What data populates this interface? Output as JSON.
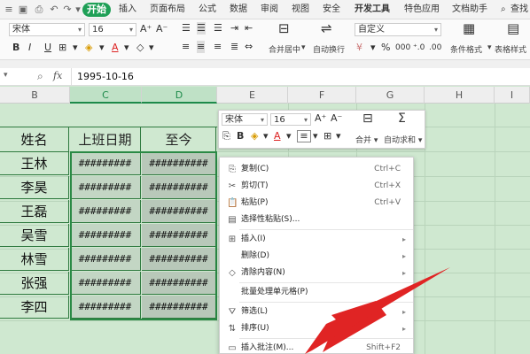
{
  "menubar": {
    "tabs": [
      "开始",
      "插入",
      "页面布局",
      "公式",
      "数据",
      "审阅",
      "视图",
      "安全",
      "开发工具",
      "特色应用",
      "文档助手"
    ],
    "search": "查找",
    "active_tab": "开始",
    "active_color": "#1fa057"
  },
  "ribbon": {
    "font_name": "宋体",
    "font_size": "16",
    "number_format": "自定义",
    "merge_label": "合并居中",
    "wrap_label": "自动换行",
    "cond_format_label": "条件格式",
    "table_style_label": "表格样式"
  },
  "formula_bar": {
    "fx": "fx",
    "value": "1995-10-16"
  },
  "columns": [
    "B",
    "C",
    "D",
    "E",
    "F",
    "G",
    "H",
    "I"
  ],
  "table": {
    "headers": [
      "姓名",
      "上班日期",
      "至今"
    ],
    "rows": [
      {
        "name": "王林",
        "c": "#########",
        "d": "##########"
      },
      {
        "name": "李昊",
        "c": "#########",
        "d": "##########"
      },
      {
        "name": "王磊",
        "c": "#########",
        "d": "##########"
      },
      {
        "name": "吴雪",
        "c": "#########",
        "d": "##########"
      },
      {
        "name": "林雪",
        "c": "#########",
        "d": "##########"
      },
      {
        "name": "张强",
        "c": "#########",
        "d": "##########"
      },
      {
        "name": "李四",
        "c": "#########",
        "d": "##########"
      }
    ]
  },
  "mini_toolbar": {
    "font_name": "宋体",
    "font_size": "16",
    "merge_label": "合并",
    "autosum_label": "自动求和"
  },
  "context_menu": {
    "items": [
      {
        "label": "复制(C)",
        "shortcut": "Ctrl+C",
        "icon": "copy-icon"
      },
      {
        "label": "剪切(T)",
        "shortcut": "Ctrl+X",
        "icon": "cut-icon"
      },
      {
        "label": "粘贴(P)",
        "shortcut": "Ctrl+V",
        "icon": "paste-icon"
      },
      {
        "label": "选择性粘贴(S)...",
        "shortcut": "",
        "icon": "paste-special-icon"
      },
      {
        "label": "插入(I)",
        "shortcut": "",
        "icon": "insert-icon"
      },
      {
        "label": "删除(D)",
        "shortcut": "",
        "icon": ""
      },
      {
        "label": "清除内容(N)",
        "shortcut": "",
        "icon": "clear-icon"
      },
      {
        "label": "批量处理单元格(P)",
        "shortcut": "",
        "icon": ""
      },
      {
        "label": "筛选(L)",
        "shortcut": "",
        "icon": "filter-icon"
      },
      {
        "label": "排序(U)",
        "shortcut": "",
        "icon": "sort-icon"
      },
      {
        "label": "插入批注(M)...",
        "shortcut": "Shift+F2",
        "icon": "comment-icon"
      }
    ]
  },
  "arrow_color": "#e02424"
}
